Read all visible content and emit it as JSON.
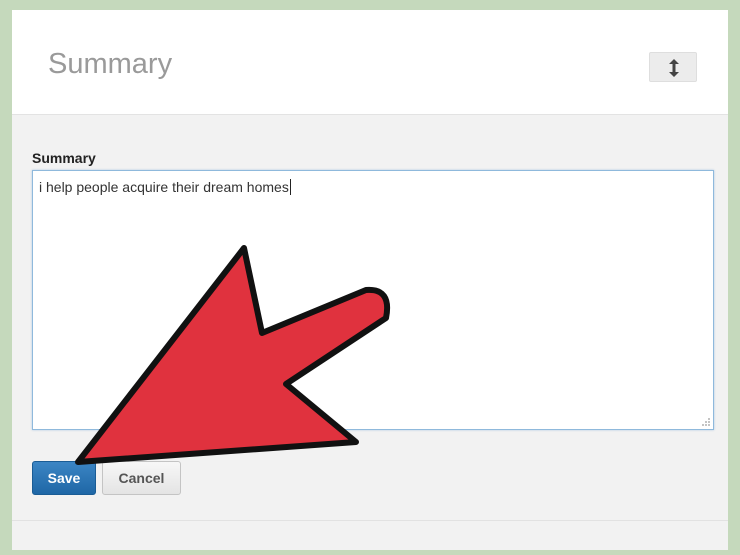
{
  "header": {
    "title": "Summary",
    "reorder_icon": "up-down-arrow-icon"
  },
  "form": {
    "field_label": "Summary",
    "summary_text": "i help people acquire their dream homes",
    "resize_icon": "resize-grip-icon"
  },
  "actions": {
    "save_label": "Save",
    "cancel_label": "Cancel"
  },
  "annotation": {
    "pointer_icon": "red-pointer-arrow",
    "pointer_color": "#e0323e"
  },
  "colors": {
    "page_background": "#c5d9bc",
    "save_button": "#2a72b3",
    "focus_border": "#8fb9dc"
  }
}
